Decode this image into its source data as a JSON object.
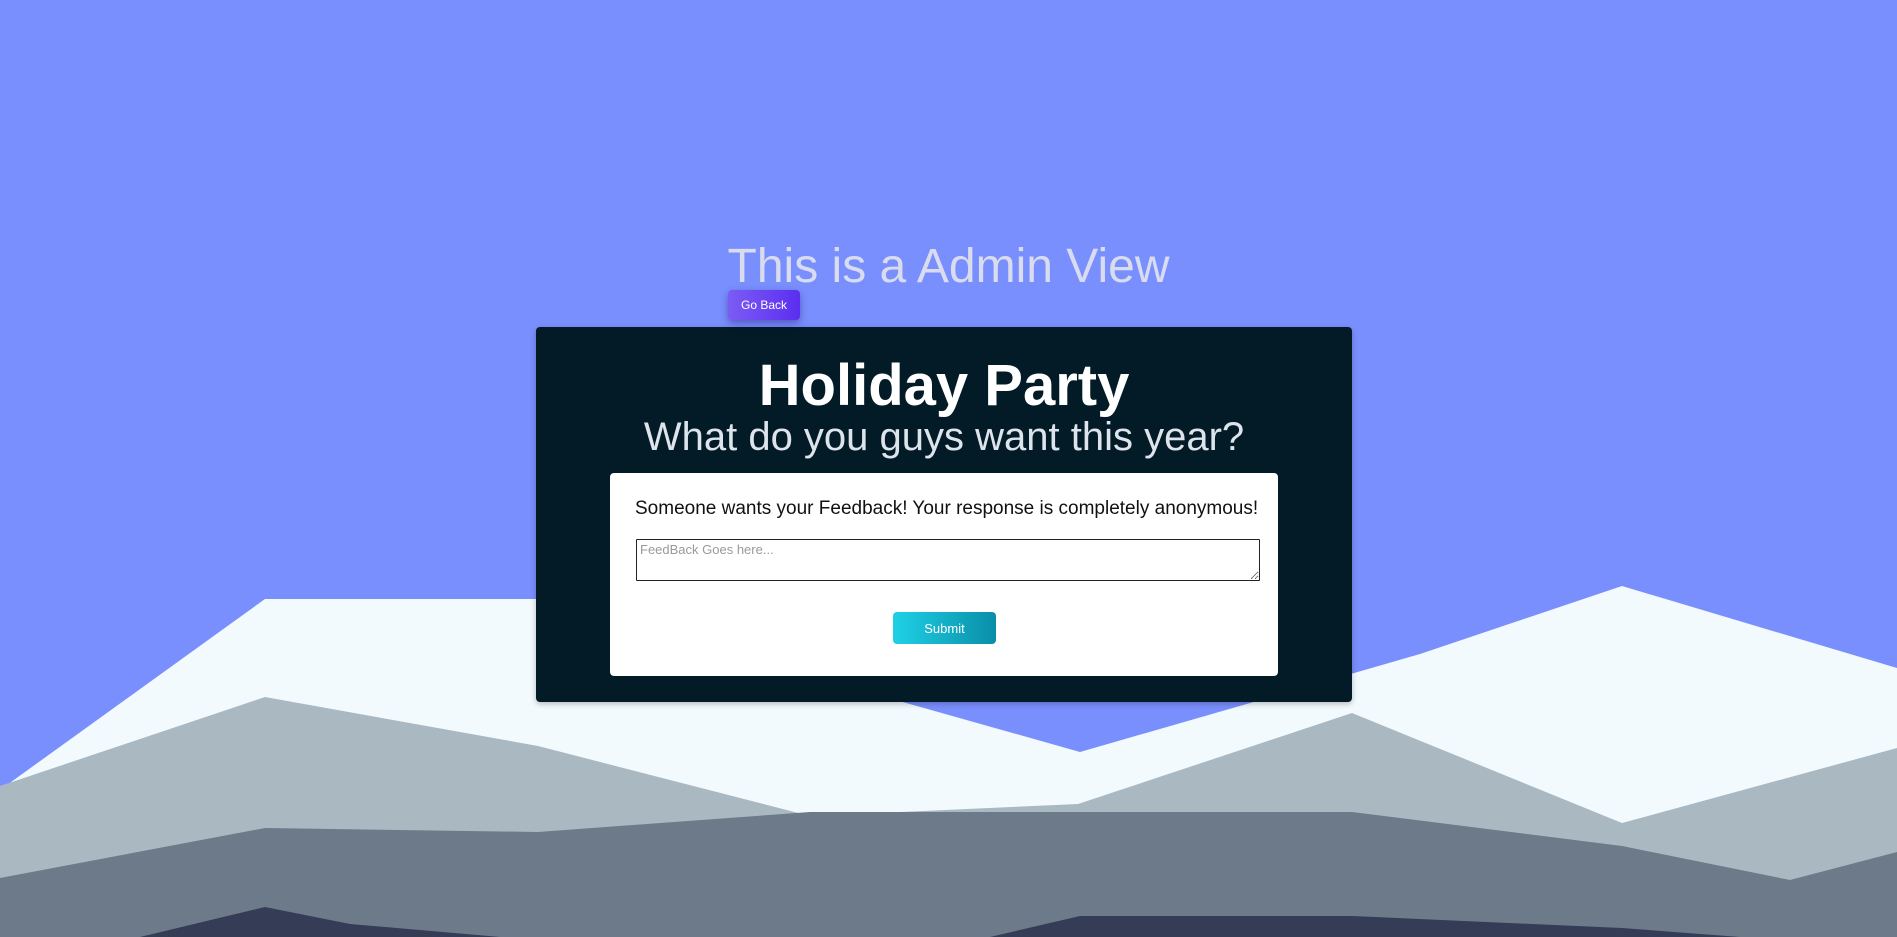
{
  "page": {
    "heading": "This is a Admin View",
    "go_back_label": "Go Back"
  },
  "card": {
    "title": "Holiday Party",
    "subtitle": "What do you guys want this year?",
    "form": {
      "prompt": "Someone wants your Feedback! Your response is completely anonymous!",
      "feedback_placeholder": "FeedBack Goes here...",
      "feedback_value": "",
      "submit_label": "Submit"
    }
  },
  "colors": {
    "sky": "#7a8ffe",
    "snow": "#f2fafe",
    "ridge_light": "#aab8c2",
    "ridge_mid": "#6c7a8a",
    "ridge_dark": "#353c56",
    "card_background": "#031b27",
    "go_back_accent": "#6a45f3",
    "submit_accent": "#14b2c8"
  }
}
